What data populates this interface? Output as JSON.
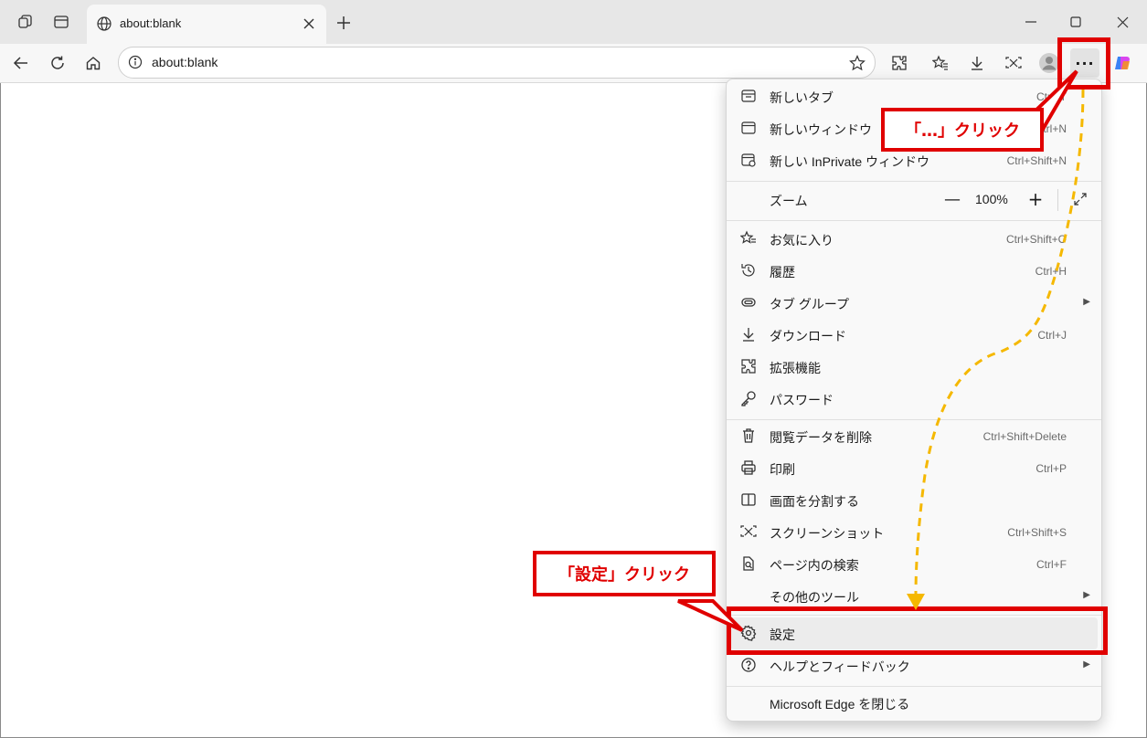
{
  "browser": {
    "tab_title": "about:blank",
    "address": "about:blank"
  },
  "menu": {
    "items": [
      {
        "label": "新しいタブ",
        "shortcut": "Ctrl+T",
        "icon": "new-tab-icon"
      },
      {
        "label": "新しいウィンドウ",
        "shortcut": "Ctrl+N",
        "icon": "new-window-icon"
      },
      {
        "label": "新しい InPrivate ウィンドウ",
        "shortcut": "Ctrl+Shift+N",
        "icon": "inprivate-icon"
      },
      {
        "label": "お気に入り",
        "shortcut": "Ctrl+Shift+O",
        "icon": "favorites-icon"
      },
      {
        "label": "履歴",
        "shortcut": "Ctrl+H",
        "icon": "history-icon"
      },
      {
        "label": "タブ グループ",
        "shortcut": "",
        "icon": "tab-group-icon"
      },
      {
        "label": "ダウンロード",
        "shortcut": "Ctrl+J",
        "icon": "download-icon"
      },
      {
        "label": "拡張機能",
        "shortcut": "",
        "icon": "extensions-icon"
      },
      {
        "label": "パスワード",
        "shortcut": "",
        "icon": "password-icon"
      },
      {
        "label": "閲覧データを削除",
        "shortcut": "Ctrl+Shift+Delete",
        "icon": "trash-icon"
      },
      {
        "label": "印刷",
        "shortcut": "Ctrl+P",
        "icon": "print-icon"
      },
      {
        "label": "画面を分割する",
        "shortcut": "",
        "icon": "split-screen-icon"
      },
      {
        "label": "スクリーンショット",
        "shortcut": "Ctrl+Shift+S",
        "icon": "screenshot-icon"
      },
      {
        "label": "ページ内の検索",
        "shortcut": "Ctrl+F",
        "icon": "find-icon"
      },
      {
        "label": "その他のツール",
        "shortcut": "",
        "icon": ""
      },
      {
        "label": "設定",
        "shortcut": "",
        "icon": "gear-icon"
      },
      {
        "label": "ヘルプとフィードバック",
        "shortcut": "",
        "icon": "help-icon"
      },
      {
        "label": "Microsoft Edge を閉じる",
        "shortcut": "",
        "icon": ""
      }
    ],
    "zoom": {
      "label": "ズーム",
      "minus": "—",
      "value": "100%",
      "plus": "+"
    }
  },
  "annotations": {
    "more_callout": "「…」クリック",
    "settings_callout": "「設定」クリック",
    "color": "#e00000",
    "arrow_color": "#f5b800"
  }
}
